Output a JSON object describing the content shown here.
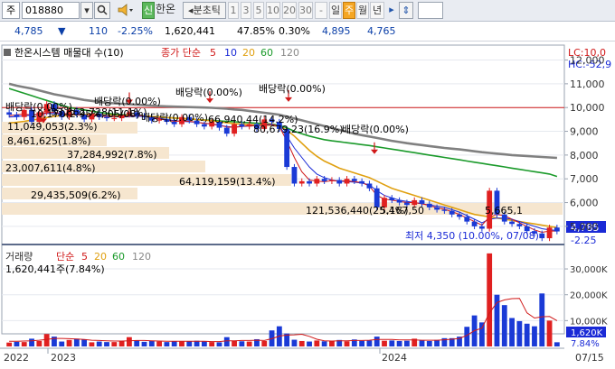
{
  "toolbar": {
    "market": "주",
    "code": "018880",
    "sound_icon": "speaker-icon",
    "tag": "신",
    "company": "한온",
    "interval_label": "◂분초틱",
    "periods": [
      "1",
      "3",
      "5",
      "10",
      "20",
      "30"
    ],
    "dropdown": "-",
    "day": "일",
    "week": "주",
    "month": "월",
    "year": "년"
  },
  "quote": {
    "price": "4,785",
    "change": "110",
    "change_pct": "-2.25%",
    "volume": "1,620,441",
    "ratio": "47.85%",
    "turnover": "0.30%",
    "open": "4,895",
    "low": "4,765"
  },
  "price_panel": {
    "legend_name": "한온시스템 매물대 수(10)",
    "ma_title": "종가 단순",
    "ma_periods": [
      "5",
      "10",
      "20",
      "60",
      "120"
    ],
    "lc_label": "LC:10,0",
    "hc_label": "HC:-52,9",
    "y_ticks": [
      "12,000",
      "11,000",
      "10,000",
      "9,000",
      "8,000",
      "7,000",
      "6,000",
      "5,000"
    ],
    "current_price_label": "4,785",
    "current_change_label": "-2.25",
    "low_annotation": "최저 4,350 (10.00%, 07/08)",
    "dividend_labels": [
      "배당락(0.00%)",
      "배당락(0.00%)",
      "배당락(0.00%)",
      "배당락(0.00%)",
      "배당락(0.00%)",
      "배당락(0.00%)"
    ],
    "volume_profile": [
      "11,049,053(2.3%)",
      "8,461,625(1.8%)",
      "37,284,992(7.8%)",
      "23,007,611(4.8%)",
      "64,119,159(13.4%)",
      "29,435,509(6.2%)",
      "121,536,440(25.4%)",
      "53,862,728(11.1%)",
      "80,679,23(16.9%)",
      "66,940,44(14.2%)",
      "10,170(2.95%, 05/08)",
      "5,167,50",
      "5,665,1"
    ]
  },
  "volume_panel": {
    "title": "거래량",
    "ma_title": "단순",
    "ma_periods": [
      "5",
      "20",
      "60",
      "120"
    ],
    "current_volume": "1,620,441주(7.84%)",
    "y_ticks": [
      "30,000K",
      "20,000K",
      "10,000K"
    ],
    "current_volume_label": "1,620K",
    "current_volume_pct": "7.84%"
  },
  "x_axis": {
    "labels": [
      "2022",
      "2023",
      "2024",
      "07/15"
    ]
  },
  "chart_data": {
    "type": "candlestick",
    "title": "한온시스템 매물대 수(10)",
    "ylim": [
      4350,
      12400
    ],
    "volume_ylim": [
      0,
      37000
    ],
    "moving_averages": [
      "5",
      "10",
      "20",
      "60",
      "120"
    ],
    "series": [
      {
        "name": "종가",
        "values": [
          9700,
          9600,
          9900,
          9400,
          9800,
          10150,
          9850,
          9600,
          9900,
          9700,
          9500,
          9750,
          9600,
          9550,
          9550,
          9700,
          9800,
          9650,
          9600,
          9450,
          9500,
          9400,
          9300,
          9600,
          9450,
          9300,
          9200,
          9400,
          9150,
          8900,
          9300,
          9200,
          9300,
          9100,
          9500,
          9400,
          9100,
          7500,
          6800,
          6900,
          6800,
          7000,
          6900,
          6950,
          6800,
          7000,
          6900,
          6800,
          6600,
          5800,
          6200,
          6100,
          6000,
          5900,
          6100,
          5950,
          5800,
          5700,
          5650,
          5500,
          5400,
          5200,
          5000,
          4900,
          6500,
          5500,
          5200,
          5100,
          5000,
          4800,
          4700,
          4500,
          4950,
          4785
        ]
      },
      {
        "name": "120",
        "values": [
          11000,
          10920,
          10860,
          10800,
          10720,
          10640,
          10560,
          10500,
          10440,
          10380,
          10320,
          10280,
          10240,
          10200,
          10180,
          10160,
          10140,
          10120,
          10100,
          10080,
          10060,
          10050,
          10040,
          10030,
          10020,
          10010,
          10000,
          9990,
          9970,
          9950,
          9920,
          9900,
          9860,
          9820,
          9780,
          9740,
          9700,
          9620,
          9540,
          9460,
          9380,
          9300,
          9220,
          9140,
          9060,
          8980,
          8900,
          8840,
          8780,
          8720,
          8660,
          8600,
          8550,
          8500,
          8460,
          8420,
          8380,
          8340,
          8300,
          8270,
          8240,
          8200,
          8160,
          8120,
          8090,
          8060,
          8030,
          8000,
          7980,
          7960,
          7940,
          7920,
          7900,
          7880
        ]
      },
      {
        "name": "60",
        "values": [
          10800,
          10700,
          10600,
          10500,
          10400,
          10300,
          10200,
          10100,
          10000,
          9950,
          9900,
          9850,
          9800,
          9760,
          9720,
          9700,
          9680,
          9660,
          9640,
          9620,
          9600,
          9580,
          9560,
          9540,
          9520,
          9500,
          9480,
          9460,
          9440,
          9420,
          9400,
          9380,
          9360,
          9340,
          9320,
          9300,
          9250,
          9150,
          9000,
          8900,
          8800,
          8720,
          8650,
          8600,
          8560,
          8520,
          8480,
          8440,
          8400,
          8350,
          8300,
          8250,
          8200,
          8150,
          8100,
          8050,
          8000,
          7950,
          7900,
          7850,
          7800,
          7750,
          7700,
          7650,
          7600,
          7550,
          7500,
          7450,
          7400,
          7350,
          7300,
          7250,
          7200,
          7100
        ]
      },
      {
        "name": "20",
        "values": [
          9350,
          9380,
          9420,
          9470,
          9520,
          9580,
          9630,
          9660,
          9690,
          9700,
          9710,
          9710,
          9700,
          9690,
          9680,
          9670,
          9660,
          9650,
          9640,
          9620,
          9600,
          9580,
          9560,
          9540,
          9520,
          9500,
          9470,
          9440,
          9400,
          9360,
          9320,
          9300,
          9280,
          9270,
          9260,
          9250,
          9200,
          9050,
          8800,
          8500,
          8200,
          7950,
          7750,
          7600,
          7450,
          7350,
          7250,
          7150,
          7050,
          6900,
          6750,
          6600,
          6500,
          6400,
          6300,
          6200,
          6100,
          6000,
          5900,
          5800,
          5700,
          5600,
          5500,
          5450,
          5400,
          5350,
          5300,
          5250,
          5200,
          5150,
          5100,
          5050,
          5000,
          4950
        ]
      },
      {
        "name": "10",
        "values": [
          9600,
          9620,
          9650,
          9680,
          9700,
          9750,
          9750,
          9730,
          9720,
          9700,
          9690,
          9680,
          9660,
          9640,
          9620,
          9600,
          9620,
          9640,
          9620,
          9580,
          9550,
          9500,
          9450,
          9420,
          9400,
          9380,
          9340,
          9300,
          9250,
          9200,
          9180,
          9200,
          9220,
          9240,
          9260,
          9280,
          9200,
          8800,
          8300,
          7900,
          7500,
          7200,
          7050,
          6950,
          6900,
          6880,
          6860,
          6820,
          6750,
          6500,
          6300,
          6200,
          6100,
          6050,
          6000,
          5950,
          5900,
          5850,
          5800,
          5700,
          5600,
          5450,
          5300,
          5150,
          5300,
          5350,
          5350,
          5300,
          5200,
          5100,
          5000,
          4900,
          4850,
          4830
        ]
      },
      {
        "name": "5",
        "values": [
          9650,
          9700,
          9720,
          9690,
          9710,
          9780,
          9800,
          9750,
          9730,
          9700,
          9680,
          9660,
          9640,
          9620,
          9600,
          9620,
          9660,
          9680,
          9640,
          9580,
          9520,
          9470,
          9420,
          9440,
          9420,
          9380,
          9330,
          9320,
          9260,
          9180,
          9170,
          9200,
          9250,
          9230,
          9280,
          9300,
          9200,
          8600,
          7900,
          7300,
          6950,
          6900,
          6880,
          6920,
          6900,
          6920,
          6880,
          6840,
          6700,
          6300,
          6150,
          6100,
          6050,
          6000,
          6000,
          5950,
          5880,
          5780,
          5720,
          5620,
          5500,
          5350,
          5200,
          5050,
          5400,
          5500,
          5450,
          5300,
          5150,
          5000,
          4850,
          4750,
          4800,
          4800
        ]
      }
    ],
    "volume": [
      1500,
      1800,
      1700,
      3000,
      2100,
      4800,
      3800,
      1900,
      2500,
      3000,
      2800,
      1600,
      1900,
      1700,
      1700,
      2100,
      3600,
      2400,
      1800,
      2200,
      1900,
      1700,
      2100,
      1900,
      2000,
      2200,
      1900,
      1700,
      1600,
      3600,
      2200,
      2000,
      1900,
      2800,
      2100,
      6200,
      7800,
      5000,
      2600,
      2100,
      1900,
      2300,
      2000,
      2100,
      2500,
      2000,
      2700,
      2200,
      2300,
      3800,
      2200,
      2300,
      2100,
      2200,
      3000,
      2300,
      2100,
      2500,
      3200,
      3200,
      3800,
      7600,
      12000,
      9300,
      36000,
      20000,
      16000,
      11000,
      9800,
      8800,
      7800,
      20500,
      10000,
      1620
    ],
    "volume_ma5": [
      2000,
      2000,
      2100,
      2200,
      2400,
      2700,
      3100,
      3100,
      3000,
      2900,
      2700,
      2400,
      2300,
      2200,
      2100,
      2100,
      2200,
      2300,
      2300,
      2200,
      2100,
      2000,
      2000,
      2000,
      2000,
      2000,
      2000,
      1900,
      1900,
      2200,
      2200,
      2300,
      2300,
      2400,
      2300,
      3000,
      4000,
      4400,
      4500,
      4700,
      3900,
      2800,
      2200,
      2100,
      2200,
      2200,
      2300,
      2300,
      2400,
      2700,
      2700,
      2700,
      2500,
      2500,
      2500,
      2400,
      2400,
      2400,
      2600,
      2800,
      3100,
      4300,
      6100,
      7100,
      13000,
      17000,
      18000,
      18500,
      18600,
      13000,
      11000,
      11500,
      11600,
      10000
    ]
  }
}
